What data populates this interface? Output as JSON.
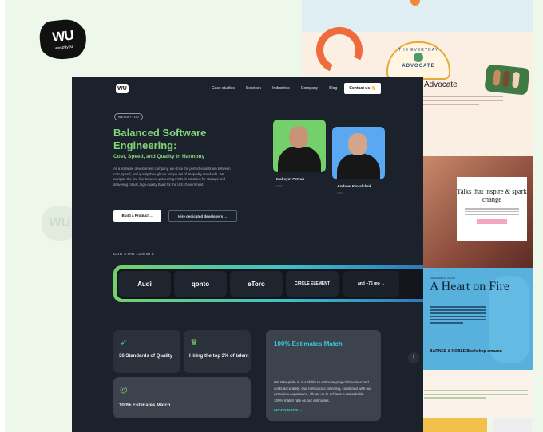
{
  "brand": {
    "logo_text": "WU",
    "logo_sub": "wesoftyou"
  },
  "nav": {
    "logo": "WU",
    "items": [
      "Case studies",
      "Services",
      "Industries",
      "Company",
      "Blog"
    ],
    "contact": "Contact us 👋"
  },
  "hero": {
    "tag": "WESOFTYOU",
    "title": "Balanced Software Engineering:",
    "subtitle": "Cost, Speed, and Quality in Harmony",
    "intro": "As a software development company, we strike the perfect equilibrium between cost, speed, and quality through our unique set of 36 quality standards. We navigate the fine line between pioneering FinTech solutions for startups and delivering robust, high-quality SaaS for the U.S. Government.",
    "btn_build": "Build a Product  →",
    "btn_hire": "Hire dedicated developers  →"
  },
  "people": [
    {
      "name": "Maksym Petruk",
      "role": "CEO"
    },
    {
      "name": "Andrew Kovalchuk",
      "role": "CTO"
    }
  ],
  "clients": {
    "label": "OUR STAR CLIENTS",
    "items": [
      "Audi",
      "qonto",
      "eToro",
      "CIRCLE ELEMENT",
      "and +75 mo →"
    ]
  },
  "cards": {
    "quality": "36 Standards of Quality",
    "hiring": "Hiring the top 3% of talent",
    "match": "100% Estimates Match"
  },
  "big_card": {
    "title": "100% Estimates Match",
    "body": "We take pride in our ability to estimate project timelines and costs accurately. Our meticulous planning, combined with our extensive experience, allows us to achieve a remarkable 100% match rate on our estimates.",
    "link": "LEARN MORE →"
  },
  "collage": {
    "badge_top": "THE EVERYDAY",
    "badge_bottom": "ADVOCATE",
    "advocate": "Advocate",
    "talks": "Talks that inspire & spark change",
    "fire_small": "AVAILABLE NOW",
    "fire_title": "A Heart on Fire",
    "fire_logos": "BARNES & NOBLE   Bookshop   amazon"
  },
  "colors": {
    "accent_green": "#82d67a",
    "accent_cyan": "#3ac6d8",
    "page_bg": "#1c222b"
  }
}
